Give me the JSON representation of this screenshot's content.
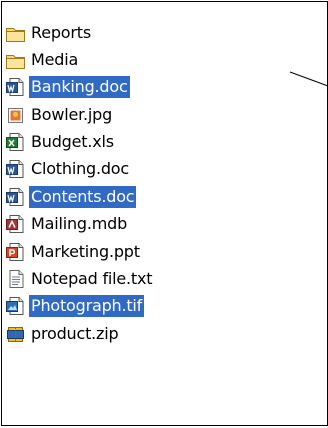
{
  "files": [
    {
      "name": "Reports",
      "icon": "folder-icon",
      "selected": false
    },
    {
      "name": "Media",
      "icon": "folder-icon",
      "selected": false
    },
    {
      "name": "Banking.doc",
      "icon": "word-document-icon",
      "selected": true
    },
    {
      "name": "Bowler.jpg",
      "icon": "jpeg-image-icon",
      "selected": false
    },
    {
      "name": "Budget.xls",
      "icon": "excel-spreadsheet-icon",
      "selected": false
    },
    {
      "name": "Clothing.doc",
      "icon": "word-document-icon",
      "selected": false
    },
    {
      "name": "Contents.doc",
      "icon": "word-document-icon",
      "selected": true
    },
    {
      "name": "Mailing.mdb",
      "icon": "access-database-icon",
      "selected": false
    },
    {
      "name": "Marketing.ppt",
      "icon": "powerpoint-presentation-icon",
      "selected": false
    },
    {
      "name": "Notepad file.txt",
      "icon": "text-file-icon",
      "selected": false
    },
    {
      "name": "Photograph.tif",
      "icon": "tiff-image-icon",
      "selected": true
    },
    {
      "name": "product.zip",
      "icon": "zip-archive-icon",
      "selected": false
    }
  ],
  "colors": {
    "selection": "#316ac5",
    "folder": "#f5d76e",
    "word": "#2b5797",
    "excel": "#1e7b34",
    "access": "#a4373a",
    "powerpoint": "#d24726"
  }
}
